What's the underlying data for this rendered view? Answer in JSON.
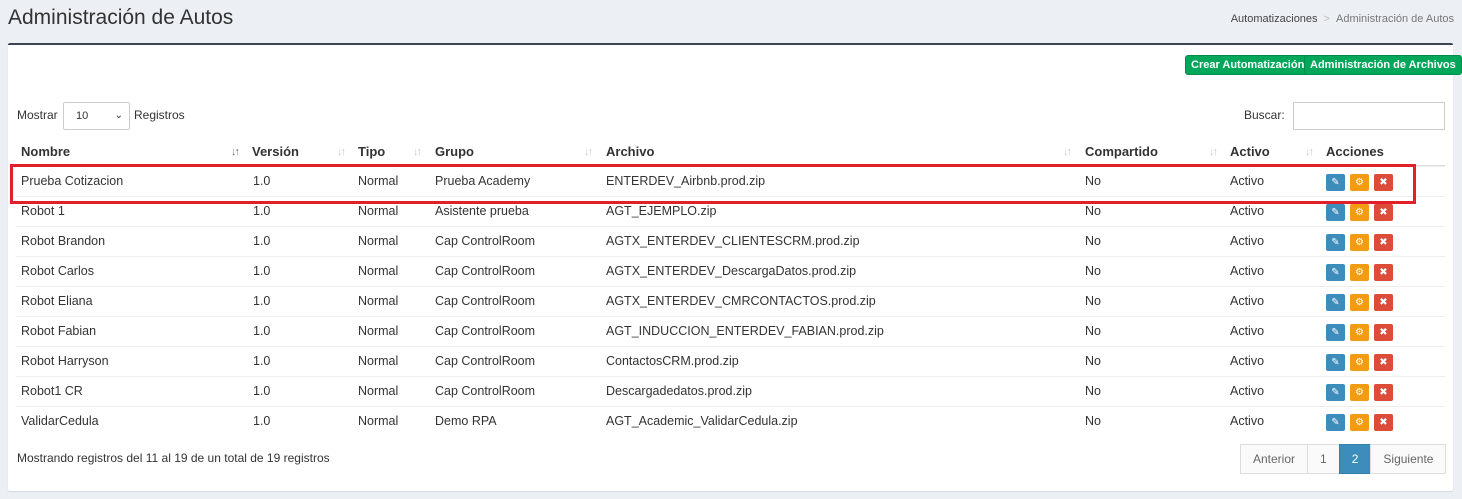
{
  "header": {
    "title": "Administración de Autos",
    "breadcrumb": [
      "Automatizaciones",
      "Administración de Autos"
    ]
  },
  "toolbar": {
    "create_label": "Crear Automatización",
    "files_label": "Administración de Archivos"
  },
  "controls": {
    "show_label": "Mostrar",
    "length_value": "10",
    "records_label": "Registros",
    "search_label": "Buscar:",
    "search_value": ""
  },
  "table": {
    "columns": [
      "Nombre",
      "Versión",
      "Tipo",
      "Grupo",
      "Archivo",
      "Compartido",
      "Activo",
      "Acciones"
    ],
    "rows": [
      [
        "Prueba Cotizacion",
        "1.0",
        "Normal",
        "Prueba Academy",
        "ENTERDEV_Airbnb.prod.zip",
        "No",
        "Activo"
      ],
      [
        "Robot 1",
        "1.0",
        "Normal",
        "Asistente prueba",
        "AGT_EJEMPLO.zip",
        "No",
        "Activo"
      ],
      [
        "Robot Brandon",
        "1.0",
        "Normal",
        "Cap ControlRoom",
        "AGTX_ENTERDEV_CLIENTESCRM.prod.zip",
        "No",
        "Activo"
      ],
      [
        "Robot Carlos",
        "1.0",
        "Normal",
        "Cap ControlRoom",
        "AGTX_ENTERDEV_DescargaDatos.prod.zip",
        "No",
        "Activo"
      ],
      [
        "Robot Eliana",
        "1.0",
        "Normal",
        "Cap ControlRoom",
        "AGTX_ENTERDEV_CMRCONTACTOS.prod.zip",
        "No",
        "Activo"
      ],
      [
        "Robot Fabian",
        "1.0",
        "Normal",
        "Cap ControlRoom",
        "AGT_INDUCCION_ENTERDEV_FABIAN.prod.zip",
        "No",
        "Activo"
      ],
      [
        "Robot Harryson",
        "1.0",
        "Normal",
        "Cap ControlRoom",
        "ContactosCRM.prod.zip",
        "No",
        "Activo"
      ],
      [
        "Robot1 CR",
        "1.0",
        "Normal",
        "Cap ControlRoom",
        "Descargadedatos.prod.zip",
        "No",
        "Activo"
      ],
      [
        "ValidarCedula",
        "1.0",
        "Normal",
        "Demo RPA",
        "AGT_Academic_ValidarCedula.zip",
        "No",
        "Activo"
      ]
    ]
  },
  "footer": {
    "info": "Mostrando registros del 11 al 19 de un total de 19 registros",
    "pagination": [
      "Anterior",
      "1",
      "2",
      "Siguiente"
    ],
    "current_page": "2"
  },
  "colors": {
    "edit": "#3c8dbc",
    "run": "#f39c12",
    "delete": "#dd4b39",
    "primary_green": "#00a65a",
    "highlight": "#e0202a"
  },
  "icons": [
    "pencil-icon",
    "robot-run-icon",
    "close-icon",
    "chevron-down-icon",
    "sort-icon"
  ]
}
